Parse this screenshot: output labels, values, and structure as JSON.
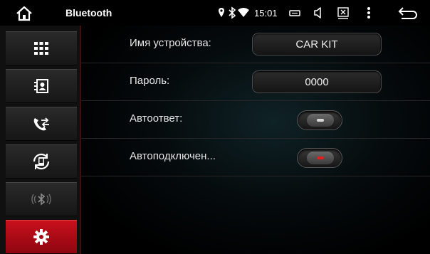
{
  "statusbar": {
    "title": "Bluetooth",
    "time": "15:01",
    "icons": [
      "home-icon",
      "location-icon",
      "bluetooth-icon",
      "wifi-icon",
      "screen-icon",
      "volume-icon",
      "close-box-icon",
      "more-vert-icon",
      "back-icon"
    ]
  },
  "sidebar": {
    "items": [
      {
        "name": "dialpad",
        "icon": "dialpad-icon",
        "active": false
      },
      {
        "name": "contacts",
        "icon": "contacts-icon",
        "active": false
      },
      {
        "name": "call-log",
        "icon": "call-transfer-icon",
        "active": false
      },
      {
        "name": "sync",
        "icon": "phone-sync-icon",
        "active": false
      },
      {
        "name": "bluetooth-audio",
        "icon": "bluetooth-audio-icon",
        "active": false
      },
      {
        "name": "settings",
        "icon": "gear-icon",
        "active": true
      }
    ]
  },
  "settings": {
    "device_name_label": "Имя устройства:",
    "device_name_value": "CAR KIT",
    "password_label": "Пароль:",
    "password_value": "0000",
    "auto_answer_label": "Автоответ:",
    "auto_answer_state": "off",
    "auto_connect_label": "Автоподключен...",
    "auto_connect_state": "on"
  },
  "colors": {
    "accent": "#c8101c",
    "toggle_off_led": "#d8d8d8",
    "toggle_on_led": "#e02020"
  }
}
